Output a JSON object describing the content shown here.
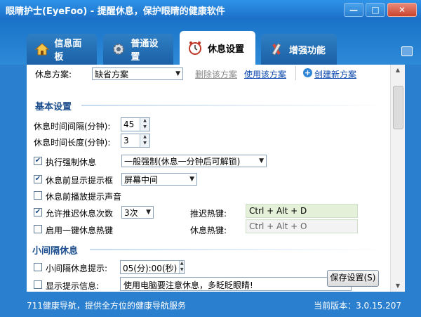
{
  "window": {
    "title": "眼睛护士(EyeFoo) - 提醒休息，保护眼睛的健康软件",
    "buttons": {
      "minimize": "—",
      "maximize": "□",
      "close": "✕"
    }
  },
  "tabs": [
    {
      "label": "信息面板",
      "icon": "house-icon"
    },
    {
      "label": "普通设置",
      "icon": "gear-icon"
    },
    {
      "label": "休息设置",
      "icon": "clock-icon"
    },
    {
      "label": "增强功能",
      "icon": "tools-icon"
    }
  ],
  "plan": {
    "label": "休息方案:",
    "selected": "缺省方案",
    "delete": "删除该方案",
    "use": "使用该方案",
    "create": "创建新方案"
  },
  "basic": {
    "title": "基本设置",
    "interval_label": "休息时间间隔(分钟):",
    "interval_value": "45",
    "length_label": "休息时间长度(分钟):",
    "length_value": "3",
    "force_label": "执行强制休息",
    "force_select": "一般强制(休息一分钟后可解锁)",
    "prompt_label": "休息前显示提示框",
    "prompt_select": "屏幕中间",
    "sound_label": "休息前播放提示声音",
    "delay_label": "允许推迟休息次数",
    "delay_select": "3次",
    "delay_hotkey_label": "推迟热键:",
    "delay_hotkey_value": "Ctrl + Alt + D",
    "onekey_label": "启用一键休息热键",
    "rest_hotkey_label": "休息热键:",
    "rest_hotkey_value": "Ctrl + Alt + O"
  },
  "small": {
    "title": "小间隔休息",
    "tip_label": "小间隔休息提示:",
    "tip_value": "05(分):00(秒)",
    "msg_label": "显示提示信息:",
    "msg_value": "使用电脑要注意休息，多眨眨眼睛!"
  },
  "save_button": "保存设置(S)",
  "status": {
    "left": "711健康导航，提供全方位的健康导航服务",
    "right": "当前版本：3.0.15.207"
  }
}
